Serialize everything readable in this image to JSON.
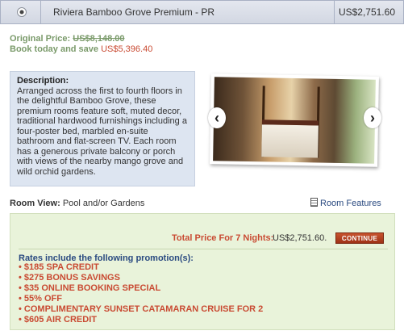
{
  "header": {
    "room_name": "Riviera Bamboo Grove Premium - PR",
    "price": "US$2,751.60"
  },
  "pricing": {
    "original_label": "Original Price:",
    "original_amount": "US$8,148.00",
    "save_label": "Book today and save",
    "save_amount": "US$5,396.40"
  },
  "description": {
    "title": "Description:",
    "text": "Arranged across the first to fourth floors in the delightful Bamboo Grove, these premium rooms feature soft, muted decor, traditional hardwood furnishings including a four-poster bed, marbled en-suite bathroom and flat-screen TV. Each room has a generous private balcony or porch with views of the nearby mango grove and wild orchid gardens."
  },
  "slider": {
    "prev_glyph": "‹",
    "next_glyph": "›"
  },
  "room_view": {
    "label": "Room View:",
    "value": "Pool and/or Gardens",
    "features_link": "Room Features"
  },
  "rates": {
    "total_label": "Total Price For 7 Nights:",
    "total_amount": "US$2,751.60.",
    "continue_label": "CONTINUE",
    "title": "Rates include the following promotion(s):",
    "promotions": [
      "• $185 SPA CREDIT",
      "• $275 BONUS SAVINGS",
      "• $35 ONLINE BOOKING SPECIAL",
      "• 55% OFF",
      "• COMPLIMENTARY SUNSET CATAMARAN CRUISE FOR 2",
      "• $605 AIR CREDIT"
    ]
  },
  "colors": {
    "header_bg": "#d2d7e2",
    "accent_red": "#c94a32",
    "green_text": "#7a9a6a",
    "desc_bg": "#dde5f1",
    "rates_bg": "#e9f3da",
    "link_blue": "#2a4a80"
  }
}
